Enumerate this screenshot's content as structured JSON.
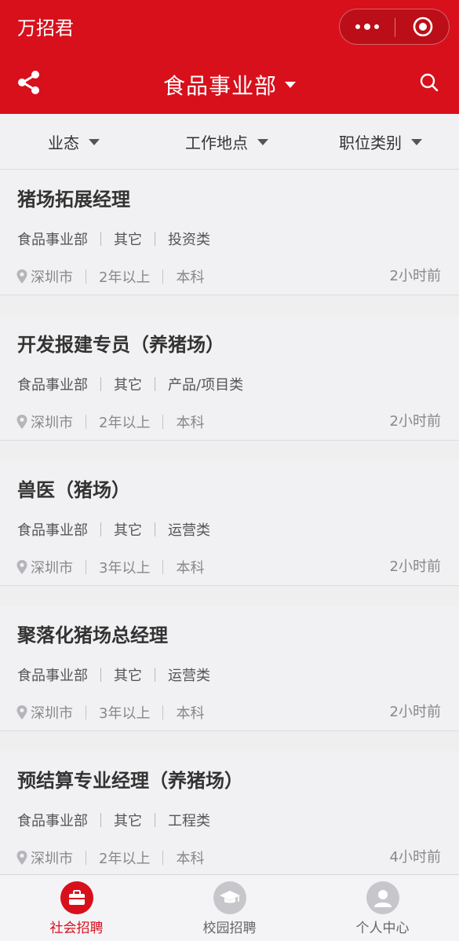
{
  "colors": {
    "brand": "#d7101c",
    "inactive_tab_icon": "#c7c7cb"
  },
  "header": {
    "app_title": "万招君",
    "department_title": "食品事业部",
    "share_icon": "share-icon",
    "search_icon": "search-icon"
  },
  "filters": [
    {
      "label": "业态"
    },
    {
      "label": "工作地点"
    },
    {
      "label": "职位类别"
    }
  ],
  "jobs": [
    {
      "title": "猪场拓展经理",
      "department": "食品事业部",
      "type": "其它",
      "category": "投资类",
      "city": "深圳市",
      "experience": "2年以上",
      "education": "本科",
      "time": "2小时前"
    },
    {
      "title": "开发报建专员（养猪场）",
      "department": "食品事业部",
      "type": "其它",
      "category": "产品/项目类",
      "city": "深圳市",
      "experience": "2年以上",
      "education": "本科",
      "time": "2小时前"
    },
    {
      "title": "兽医（猪场）",
      "department": "食品事业部",
      "type": "其它",
      "category": "运营类",
      "city": "深圳市",
      "experience": "3年以上",
      "education": "本科",
      "time": "2小时前"
    },
    {
      "title": "聚落化猪场总经理",
      "department": "食品事业部",
      "type": "其它",
      "category": "运营类",
      "city": "深圳市",
      "experience": "3年以上",
      "education": "本科",
      "time": "2小时前"
    },
    {
      "title": "预结算专业经理（养猪场）",
      "department": "食品事业部",
      "type": "其它",
      "category": "工程类",
      "city": "深圳市",
      "experience": "2年以上",
      "education": "本科",
      "time": "4小时前"
    }
  ],
  "tabbar": [
    {
      "label": "社会招聘",
      "icon": "briefcase-icon",
      "active": true
    },
    {
      "label": "校园招聘",
      "icon": "graduation-cap-icon",
      "active": false
    },
    {
      "label": "个人中心",
      "icon": "user-icon",
      "active": false
    }
  ]
}
